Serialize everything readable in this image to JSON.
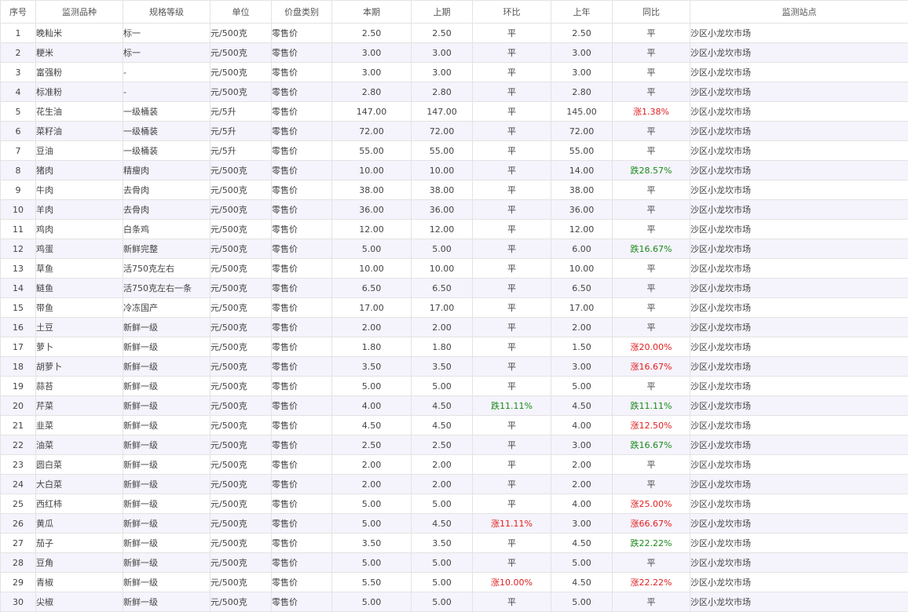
{
  "colors": {
    "up": "#e02020",
    "down": "#1a8a1a",
    "highlight_header": "#e02020",
    "stripe": "#f5f3fb"
  },
  "headers": [
    "序号",
    "监测品种",
    "规格等级",
    "单位",
    "价盘类别",
    "本期",
    "上期",
    "环比",
    "上年",
    "同比",
    "监测站点"
  ],
  "highlight_column": 5,
  "rows": [
    [
      "1",
      "晚籼米",
      "标一",
      "元/500克",
      "零售价",
      "2.50",
      "2.50",
      "平",
      "2.50",
      "平",
      "沙区小龙坎市场"
    ],
    [
      "2",
      "粳米",
      "标一",
      "元/500克",
      "零售价",
      "3.00",
      "3.00",
      "平",
      "3.00",
      "平",
      "沙区小龙坎市场"
    ],
    [
      "3",
      "富强粉",
      "-",
      "元/500克",
      "零售价",
      "3.00",
      "3.00",
      "平",
      "3.00",
      "平",
      "沙区小龙坎市场"
    ],
    [
      "4",
      "标准粉",
      "-",
      "元/500克",
      "零售价",
      "2.80",
      "2.80",
      "平",
      "2.80",
      "平",
      "沙区小龙坎市场"
    ],
    [
      "5",
      "花生油",
      "一级桶装",
      "元/5升",
      "零售价",
      "147.00",
      "147.00",
      "平",
      "145.00",
      "涨1.38%",
      "沙区小龙坎市场"
    ],
    [
      "6",
      "菜籽油",
      "一级桶装",
      "元/5升",
      "零售价",
      "72.00",
      "72.00",
      "平",
      "72.00",
      "平",
      "沙区小龙坎市场"
    ],
    [
      "7",
      "豆油",
      "一级桶装",
      "元/5升",
      "零售价",
      "55.00",
      "55.00",
      "平",
      "55.00",
      "平",
      "沙区小龙坎市场"
    ],
    [
      "8",
      "猪肉",
      "精瘦肉",
      "元/500克",
      "零售价",
      "10.00",
      "10.00",
      "平",
      "14.00",
      "跌28.57%",
      "沙区小龙坎市场"
    ],
    [
      "9",
      "牛肉",
      "去骨肉",
      "元/500克",
      "零售价",
      "38.00",
      "38.00",
      "平",
      "38.00",
      "平",
      "沙区小龙坎市场"
    ],
    [
      "10",
      "羊肉",
      "去骨肉",
      "元/500克",
      "零售价",
      "36.00",
      "36.00",
      "平",
      "36.00",
      "平",
      "沙区小龙坎市场"
    ],
    [
      "11",
      "鸡肉",
      "白条鸡",
      "元/500克",
      "零售价",
      "12.00",
      "12.00",
      "平",
      "12.00",
      "平",
      "沙区小龙坎市场"
    ],
    [
      "12",
      "鸡蛋",
      "新鲜完整",
      "元/500克",
      "零售价",
      "5.00",
      "5.00",
      "平",
      "6.00",
      "跌16.67%",
      "沙区小龙坎市场"
    ],
    [
      "13",
      "草鱼",
      "活750克左右",
      "元/500克",
      "零售价",
      "10.00",
      "10.00",
      "平",
      "10.00",
      "平",
      "沙区小龙坎市场"
    ],
    [
      "14",
      "鲢鱼",
      "活750克左右一条",
      "元/500克",
      "零售价",
      "6.50",
      "6.50",
      "平",
      "6.50",
      "平",
      "沙区小龙坎市场"
    ],
    [
      "15",
      "带鱼",
      "冷冻国产",
      "元/500克",
      "零售价",
      "17.00",
      "17.00",
      "平",
      "17.00",
      "平",
      "沙区小龙坎市场"
    ],
    [
      "16",
      "土豆",
      "新鲜一级",
      "元/500克",
      "零售价",
      "2.00",
      "2.00",
      "平",
      "2.00",
      "平",
      "沙区小龙坎市场"
    ],
    [
      "17",
      "萝卜",
      "新鲜一级",
      "元/500克",
      "零售价",
      "1.80",
      "1.80",
      "平",
      "1.50",
      "涨20.00%",
      "沙区小龙坎市场"
    ],
    [
      "18",
      "胡萝卜",
      "新鲜一级",
      "元/500克",
      "零售价",
      "3.50",
      "3.50",
      "平",
      "3.00",
      "涨16.67%",
      "沙区小龙坎市场"
    ],
    [
      "19",
      "蒜苔",
      "新鲜一级",
      "元/500克",
      "零售价",
      "5.00",
      "5.00",
      "平",
      "5.00",
      "平",
      "沙区小龙坎市场"
    ],
    [
      "20",
      "芹菜",
      "新鲜一级",
      "元/500克",
      "零售价",
      "4.00",
      "4.50",
      "跌11.11%",
      "4.50",
      "跌11.11%",
      "沙区小龙坎市场"
    ],
    [
      "21",
      "韭菜",
      "新鲜一级",
      "元/500克",
      "零售价",
      "4.50",
      "4.50",
      "平",
      "4.00",
      "涨12.50%",
      "沙区小龙坎市场"
    ],
    [
      "22",
      "油菜",
      "新鲜一级",
      "元/500克",
      "零售价",
      "2.50",
      "2.50",
      "平",
      "3.00",
      "跌16.67%",
      "沙区小龙坎市场"
    ],
    [
      "23",
      "圆白菜",
      "新鲜一级",
      "元/500克",
      "零售价",
      "2.00",
      "2.00",
      "平",
      "2.00",
      "平",
      "沙区小龙坎市场"
    ],
    [
      "24",
      "大白菜",
      "新鲜一级",
      "元/500克",
      "零售价",
      "2.00",
      "2.00",
      "平",
      "2.00",
      "平",
      "沙区小龙坎市场"
    ],
    [
      "25",
      "西红柿",
      "新鲜一级",
      "元/500克",
      "零售价",
      "5.00",
      "5.00",
      "平",
      "4.00",
      "涨25.00%",
      "沙区小龙坎市场"
    ],
    [
      "26",
      "黄瓜",
      "新鲜一级",
      "元/500克",
      "零售价",
      "5.00",
      "4.50",
      "涨11.11%",
      "3.00",
      "涨66.67%",
      "沙区小龙坎市场"
    ],
    [
      "27",
      "茄子",
      "新鲜一级",
      "元/500克",
      "零售价",
      "3.50",
      "3.50",
      "平",
      "4.50",
      "跌22.22%",
      "沙区小龙坎市场"
    ],
    [
      "28",
      "豆角",
      "新鲜一级",
      "元/500克",
      "零售价",
      "5.00",
      "5.00",
      "平",
      "5.00",
      "平",
      "沙区小龙坎市场"
    ],
    [
      "29",
      "青椒",
      "新鲜一级",
      "元/500克",
      "零售价",
      "5.50",
      "5.00",
      "涨10.00%",
      "4.50",
      "涨22.22%",
      "沙区小龙坎市场"
    ],
    [
      "30",
      "尖椒",
      "新鲜一级",
      "元/500克",
      "零售价",
      "5.00",
      "5.00",
      "平",
      "5.00",
      "平",
      "沙区小龙坎市场"
    ]
  ]
}
